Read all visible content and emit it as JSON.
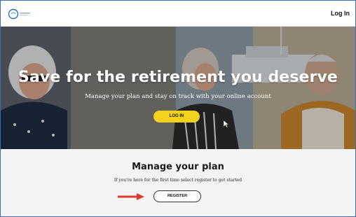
{
  "header": {
    "logo_icon": "company-logo-icon",
    "login_link": "Log In"
  },
  "hero": {
    "title": "Save for the retirement you deserve",
    "subtitle": "Manage your plan and stay on track with your online account",
    "login_button": "LOG IN",
    "accent_color": "#f2d21c"
  },
  "plan_section": {
    "title": "Manage your plan",
    "subtitle": "If you're here for the first time select register to get started",
    "register_button": "REGISTER",
    "annotation_icon": "red-arrow-icon",
    "annotation_color": "#e03a2f"
  }
}
